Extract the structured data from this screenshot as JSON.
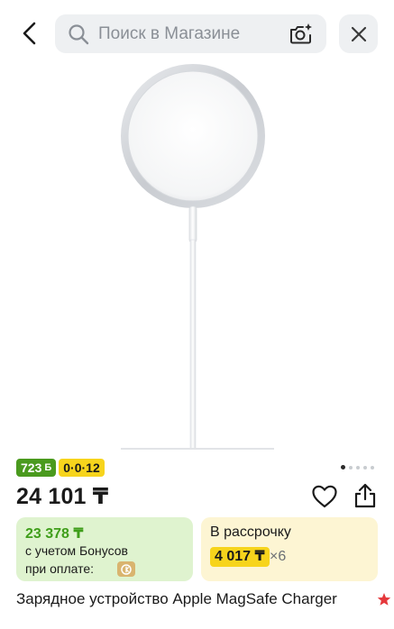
{
  "search": {
    "placeholder": "Поиск в Магазине"
  },
  "icons": {
    "back": "chevron-left-icon",
    "search": "search-icon",
    "camera": "camera-sparkle-icon",
    "close": "close-icon",
    "favorite": "heart-icon",
    "share": "share-icon",
    "rating": "star-icon",
    "kaspi": "kaspi-logo-icon"
  },
  "product": {
    "image_alt": "MagSafe charger",
    "price": "24 101 ₸",
    "title": "Зарядное устройство Apple MagSafe Charger"
  },
  "badges": {
    "bonus": "723",
    "bonus_currency": "Б",
    "installment": "0·0·12"
  },
  "gallery": {
    "total": 5,
    "active_index": 0
  },
  "bonus_card": {
    "amount": "23 378 ₸",
    "line1": "с учетом Бонусов",
    "line2": "при оплате:"
  },
  "installment_card": {
    "title": "В рассрочку",
    "monthly": "4 017 ₸",
    "times": "×6"
  },
  "colors": {
    "accent_green": "#3f9e1a",
    "badge_green": "#4a9a1e",
    "badge_yellow": "#f7d41c",
    "bonus_bg": "#dff3cf",
    "install_bg": "#fdf5d3",
    "star_red": "#e5383b"
  }
}
